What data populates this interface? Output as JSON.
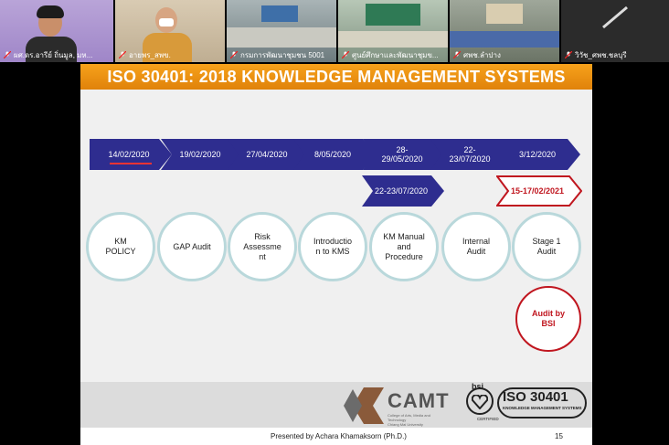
{
  "participants": [
    {
      "name": "ผศ.ดร.อารีย์ ถิ่นมูล, มห..."
    },
    {
      "name": "อายพร_สพข."
    },
    {
      "name": "กรมการพัฒนาชุมชน 5001"
    },
    {
      "name": "ศูนย์ศึกษาและพัฒนาชุมข..."
    },
    {
      "name": "ศพช.ลำปาง"
    },
    {
      "name": "วิวัช_ศพช.ชลบุรี"
    }
  ],
  "slide": {
    "title": "ISO 30401: 2018 KNOWLEDGE MANAGEMENT SYSTEMS",
    "dates": [
      "14/02/2020",
      "19/02/2020",
      "27/04/2020",
      "8/05/2020",
      "28-\n29/05/2020",
      "22-\n23/07/2020",
      "3/12/2020"
    ],
    "date_extra": "22-23/07/2020",
    "date_red": "15-17/02/2021",
    "steps": [
      "KM\nPOLICY",
      "GAP Audit",
      "Risk\nAssessme\nnt",
      "Introductio\nn to KMS",
      "KM Manual\nand\nProcedure",
      "Internal\nAudit",
      "Stage 1\nAudit"
    ],
    "audit_bsi": "Audit by\nBSI",
    "logo_camt": "CAMT",
    "logo_camt_sub": "College of Arts, Media and Technology\nChiang Mai University",
    "logo_bsi": "bsi",
    "logo_iso": "ISO 30401",
    "logo_iso_sub": "KNOWLEDGE MANAGEMENT SYSTEMS",
    "logo_certified": "CERTIFIED",
    "presenter": "Presented by Achara Khamaksorn (Ph.D.)",
    "page": "15"
  },
  "colors": {
    "accent": "#f39a1a",
    "chevron": "#2e2d8f",
    "red": "#c0161f",
    "circle_border": "#b9d8db"
  }
}
